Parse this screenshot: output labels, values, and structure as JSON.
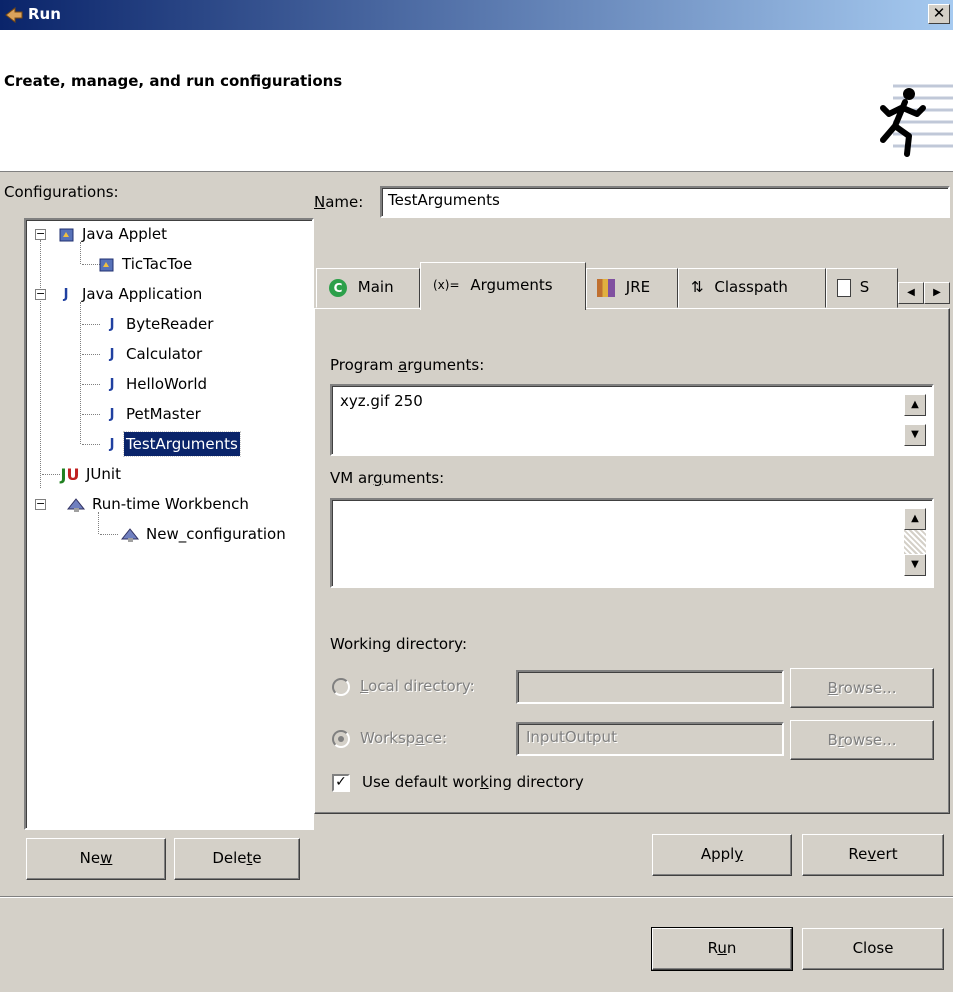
{
  "window": {
    "title": "Run",
    "close_glyph": "✕"
  },
  "header": {
    "title": "Create, manage, and run configurations",
    "icon": "running-man-icon"
  },
  "left": {
    "label": "Configurations:",
    "tree": [
      {
        "label": "Java Applet",
        "icon": "java-applet-icon"
      },
      {
        "label": "TicTacToe",
        "icon": "java-applet-icon"
      },
      {
        "label": "Java Application",
        "icon": "java-application-icon"
      },
      {
        "label": "ByteReader",
        "icon": "java-application-icon"
      },
      {
        "label": "Calculator",
        "icon": "java-application-icon"
      },
      {
        "label": "HelloWorld",
        "icon": "java-application-icon"
      },
      {
        "label": "PetMaster",
        "icon": "java-application-icon"
      },
      {
        "label": "TestArguments",
        "icon": "java-application-icon",
        "selected": true
      },
      {
        "label": "JUnit",
        "icon": "junit-icon"
      },
      {
        "label": "Run-time Workbench",
        "icon": "workbench-icon"
      },
      {
        "label": "New_configuration",
        "icon": "workbench-icon"
      }
    ],
    "new_button": {
      "pre": "Ne",
      "u": "w",
      "post": ""
    },
    "delete_button": {
      "pre": "Dele",
      "u": "t",
      "post": "e"
    }
  },
  "name_field": {
    "label_u": "N",
    "label_rest": "ame:",
    "value": "TestArguments"
  },
  "tabs": [
    {
      "label": "Main",
      "icon": "main-tab-icon"
    },
    {
      "label": "Arguments",
      "icon": "arguments-tab-icon",
      "active": true
    },
    {
      "label": "JRE",
      "icon": "jre-tab-icon"
    },
    {
      "label": "Classpath",
      "icon": "classpath-tab-icon"
    },
    {
      "label": "S",
      "icon": "source-tab-icon"
    }
  ],
  "arguments_tab": {
    "program_args_label": {
      "pre": "Program ",
      "u": "a",
      "post": "rguments:"
    },
    "program_args_value": "xyz.gif 250",
    "vm_args_label": {
      "pre": "VM ar",
      "u": "g",
      "post": "uments:"
    },
    "vm_args_value": "",
    "working_dir_label": "Working directory:",
    "local_dir": {
      "label_u": "L",
      "label_rest": "ocal directory:",
      "value": "",
      "browse_pre": "",
      "browse_u": "B",
      "browse_post": "rowse..."
    },
    "workspace": {
      "label_pre": "Worksp",
      "label_u": "a",
      "label_post": "ce:",
      "value": "InputOutput",
      "browse_pre": "B",
      "browse_u": "r",
      "browse_post": "owse..."
    },
    "use_default": {
      "pre": "Use default wor",
      "u": "k",
      "post": "ing directory",
      "checked": true
    }
  },
  "apply_button": {
    "pre": "Appl",
    "u": "y",
    "post": ""
  },
  "revert_button": {
    "pre": "Re",
    "u": "v",
    "post": "ert"
  },
  "run_button": {
    "pre": "R",
    "u": "u",
    "post": "n"
  },
  "close_button": {
    "label": "Close"
  }
}
